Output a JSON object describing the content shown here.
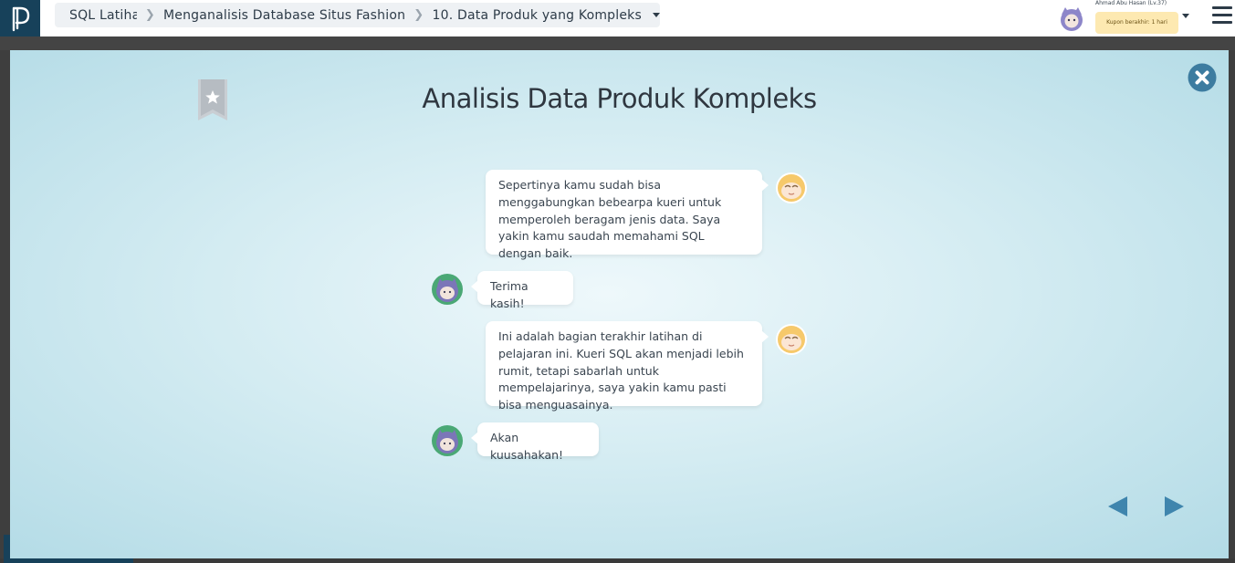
{
  "breadcrumb": {
    "course": "SQL Latihan I",
    "lesson": "Menganalisis Database Situs Fashion",
    "exercise": "10. Data Produk yang Kompleks"
  },
  "user": {
    "name": "Ahmad Abu Hasan (Lv.37)",
    "coupon": "Kupon berakhir: 1 hari"
  },
  "modal": {
    "title": "Analisis Data Produk Kompleks"
  },
  "dialog": [
    {
      "speaker": "mentor",
      "side": "right",
      "text": "Sepertinya kamu sudah bisa menggabungkan bebearpa kueri untuk memperoleh beragam jenis data. Saya yakin kamu saudah memahami SQL dengan baik."
    },
    {
      "speaker": "student",
      "side": "left",
      "text": "Terima kasih!"
    },
    {
      "speaker": "mentor",
      "side": "right",
      "text": "Ini adalah bagian terakhir latihan di pelajaran ini. Kueri SQL akan menjadi lebih rumit, tetapi sabarlah untuk mempelajarinya, saya yakin kamu pasti bisa menguasainya."
    },
    {
      "speaker": "student",
      "side": "left",
      "text": "Akan kuusahakan!"
    }
  ],
  "icons": {
    "logo": "progate-logo-icon",
    "bookmark": "bookmark-star-icon",
    "close": "close-icon",
    "prev": "previous-arrow-icon",
    "next": "next-arrow-icon",
    "menu": "hamburger-menu-icon"
  },
  "colors": {
    "logo_bg": "#17415a",
    "close": "#3d7ca0",
    "arrow": "#3f85ad",
    "coupon_bg": "#fde9b1",
    "student_avatar_ring": "#4aa875",
    "mentor_avatar": "#f6c96b"
  }
}
